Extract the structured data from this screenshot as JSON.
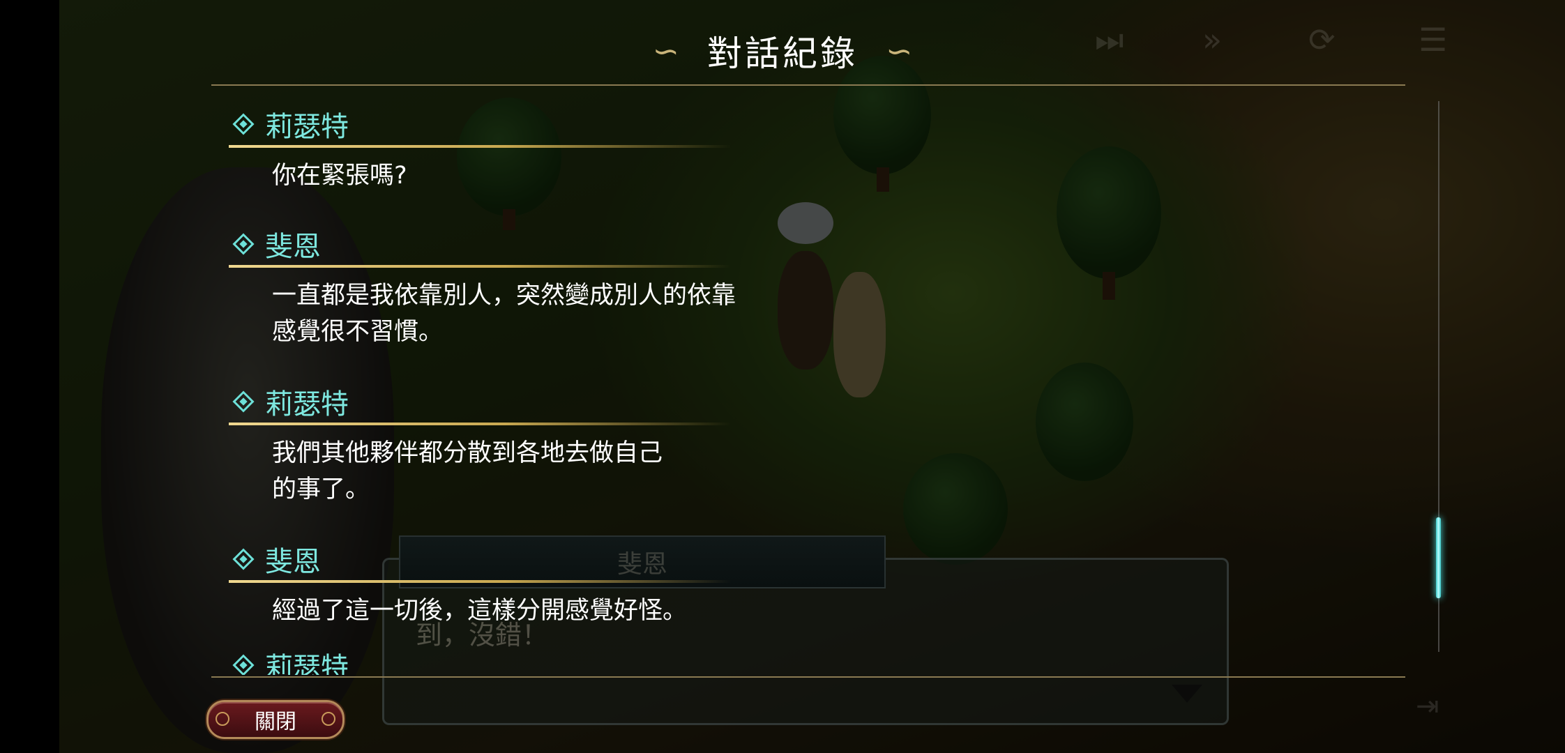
{
  "header": {
    "title": "對話紀錄"
  },
  "log_entries": [
    {
      "speaker": "莉瑟特",
      "lines": [
        "你在緊張嗎?"
      ]
    },
    {
      "speaker": "斐恩",
      "lines": [
        "一直都是我依靠別人，突然變成別人的依靠",
        "感覺很不習慣。"
      ]
    },
    {
      "speaker": "莉瑟特",
      "lines": [
        "我們其他夥伴都分散到各地去做自己",
        "的事了。"
      ]
    },
    {
      "speaker": "斐恩",
      "lines": [
        "經過了這一切後，這樣分開感覺好怪。"
      ]
    }
  ],
  "partial_entry": {
    "speaker": "莉瑟特"
  },
  "game_dialog": {
    "speaker": "斐恩",
    "line": "到，沒錯！"
  },
  "hud": {
    "icons": [
      "skip-all-icon",
      "fast-forward-icon",
      "auto-play-icon",
      "log-icon"
    ]
  },
  "footer": {
    "close_label": "關閉"
  },
  "scroll": {
    "position_fraction": 0.8
  },
  "colors": {
    "speaker": "#7ee8e0",
    "accent_gold": "#c8a850",
    "button": "#6a1a1e"
  }
}
